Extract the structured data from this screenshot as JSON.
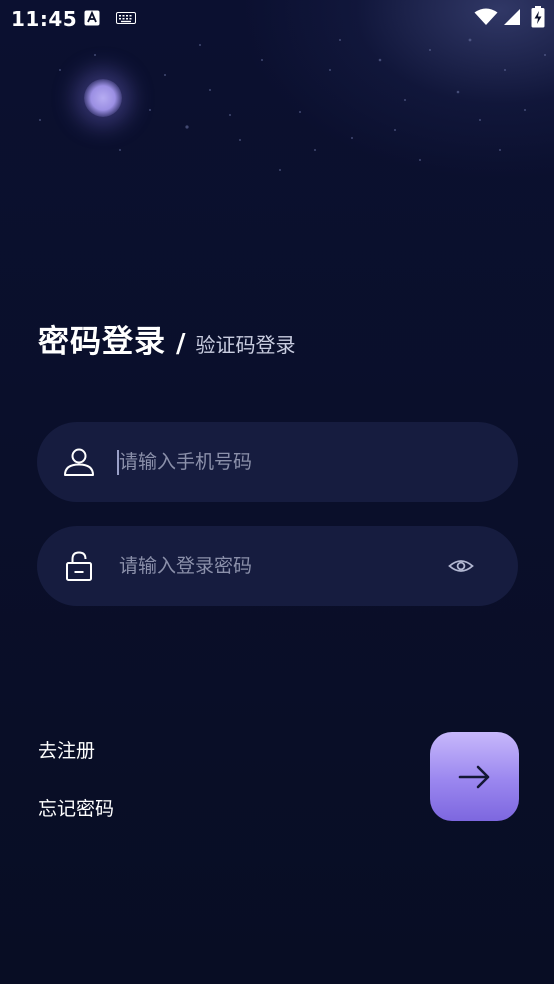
{
  "status_bar": {
    "time": "11:45",
    "icons": [
      "a-notification-icon",
      "keyboard-icon",
      "wifi-icon",
      "signal-icon",
      "battery-charging-icon"
    ]
  },
  "login": {
    "title_active": "密码登录",
    "separator": "/",
    "title_alt": "验证码登录"
  },
  "phone_field": {
    "icon": "user-icon",
    "placeholder": "请输入手机号码",
    "value": ""
  },
  "password_field": {
    "icon": "lock-icon",
    "placeholder": "请输入登录密码",
    "value": "",
    "toggle_icon": "eye-icon"
  },
  "links": {
    "register": "去注册",
    "forgot": "忘记密码"
  },
  "submit": {
    "icon": "arrow-right-icon"
  },
  "colors": {
    "background": "#0a0f29",
    "field_bg": "#161c3f",
    "placeholder": "#8b90aa",
    "accent_top": "#c7b8fb",
    "accent_bottom": "#7d67df"
  }
}
